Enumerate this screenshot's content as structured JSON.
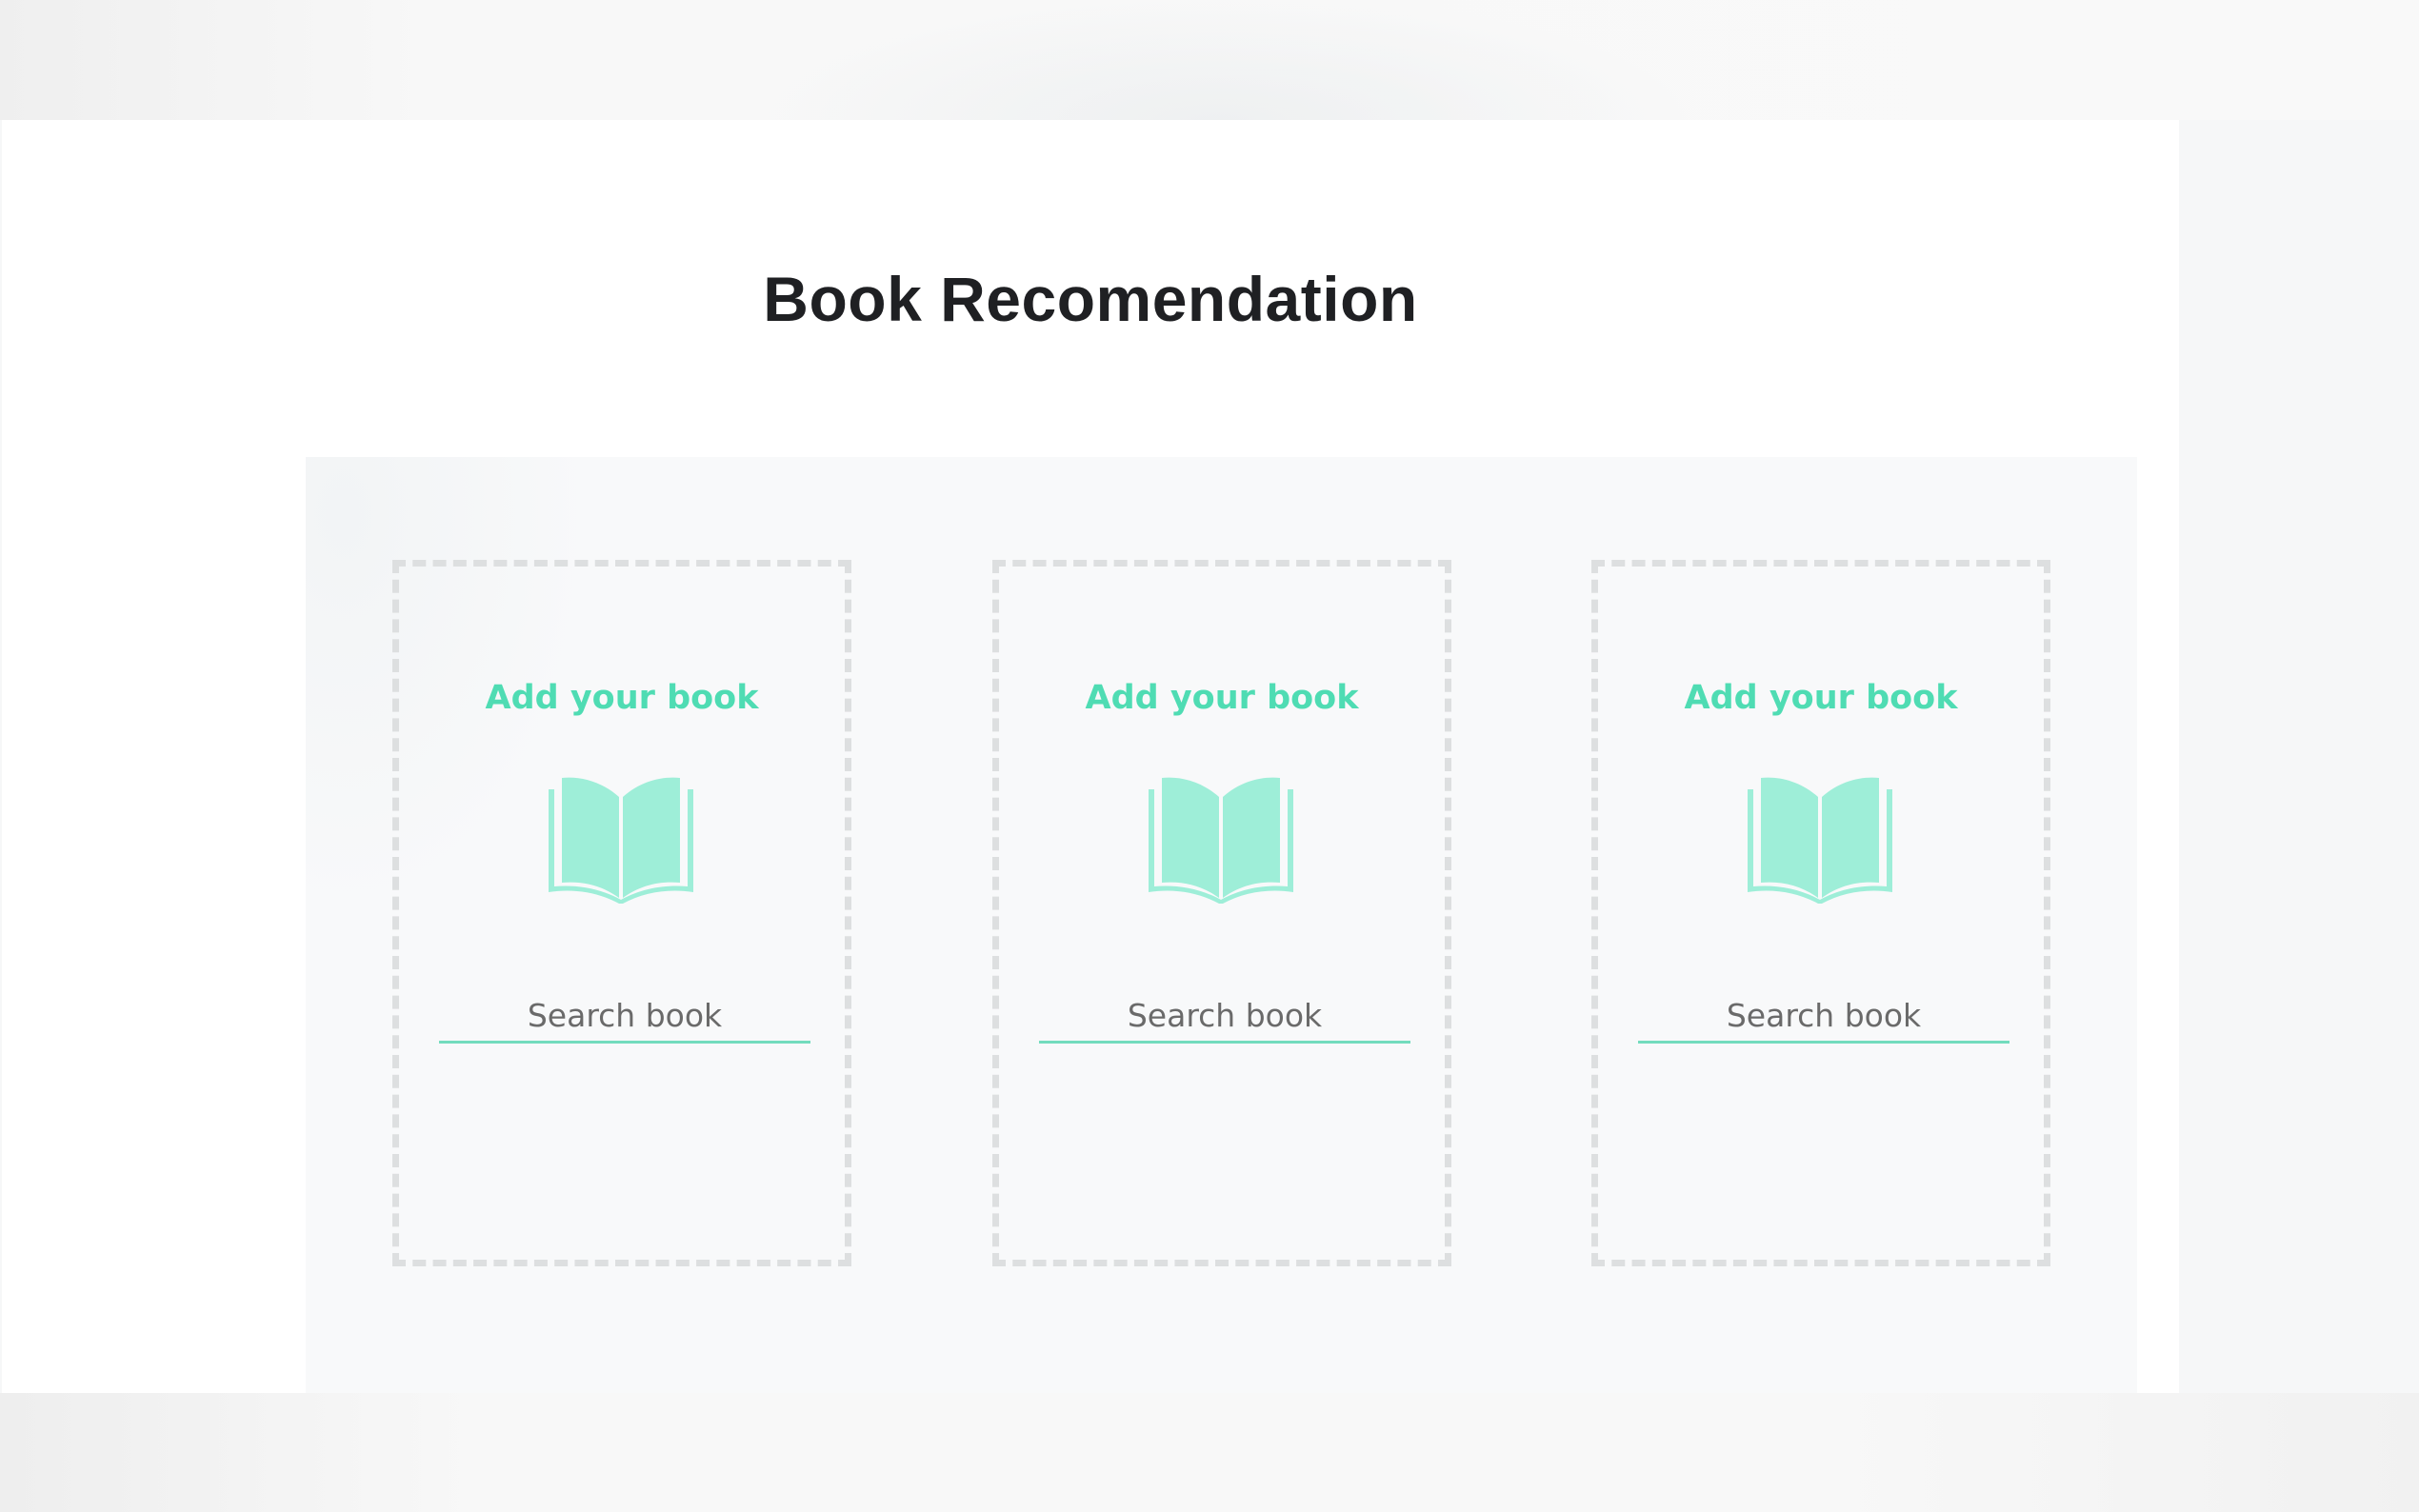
{
  "page": {
    "title": "Book Recomendation"
  },
  "cards": [
    {
      "heading": "Add your book",
      "icon": "open-book-icon",
      "search_placeholder": "Search book"
    },
    {
      "heading": "Add your book",
      "icon": "open-book-icon",
      "search_placeholder": "Search book"
    },
    {
      "heading": "Add your book",
      "icon": "open-book-icon",
      "search_placeholder": "Search book"
    }
  ],
  "colors": {
    "accent": "#4fdcb3",
    "icon_fill": "#9eeed8",
    "card_border": "#dddfe0",
    "input_underline": "#73dcbd",
    "title_text": "#1f2023"
  }
}
